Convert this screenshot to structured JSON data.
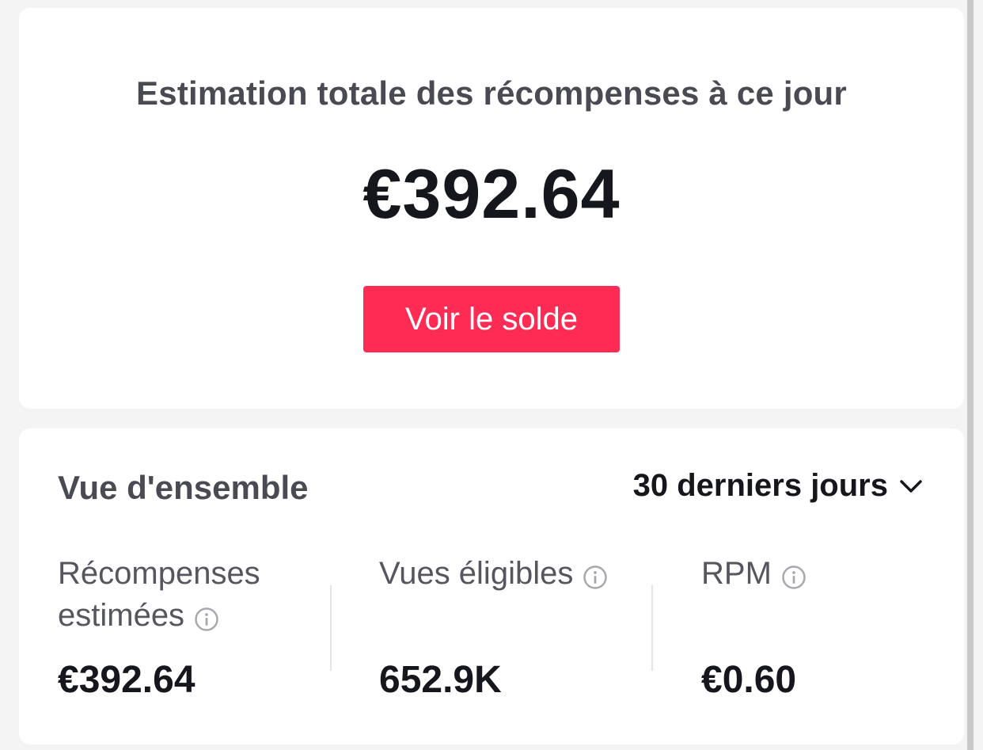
{
  "summary": {
    "title": "Estimation totale des récompenses à ce jour",
    "amount": "€392.64",
    "button_label": "Voir le solde"
  },
  "overview": {
    "title": "Vue d'ensemble",
    "period": "30 derniers jours",
    "metrics": [
      {
        "label": "Récompenses estimées",
        "value": "€392.64",
        "icon": "info-icon"
      },
      {
        "label": "Vues éligibles",
        "value": "652.9K",
        "icon": "info-icon"
      },
      {
        "label": "RPM",
        "value": "€0.60",
        "icon": "info-icon"
      }
    ]
  },
  "colors": {
    "accent": "#fe2c55",
    "text_primary": "#16171d",
    "text_secondary": "#4a4b52",
    "background": "#f4f4f5",
    "card": "#ffffff"
  }
}
